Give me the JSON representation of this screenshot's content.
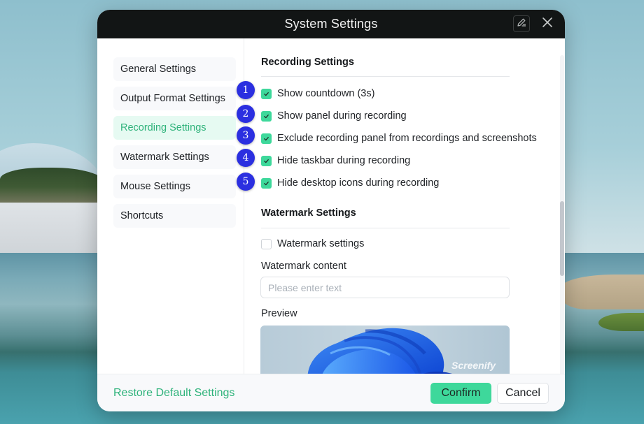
{
  "window": {
    "title": "System Settings",
    "edit_icon": "pen-edit-icon",
    "close_icon": "close-icon"
  },
  "sidebar": {
    "items": [
      {
        "label": "General Settings",
        "active": false
      },
      {
        "label": "Output Format Settings",
        "active": false
      },
      {
        "label": "Recording Settings",
        "active": true
      },
      {
        "label": "Watermark Settings",
        "active": false
      },
      {
        "label": "Mouse Settings",
        "active": false
      },
      {
        "label": "Shortcuts",
        "active": false
      }
    ]
  },
  "recording": {
    "title": "Recording Settings",
    "options": [
      {
        "label": "Show countdown (3s)",
        "checked": true
      },
      {
        "label": "Show panel during recording",
        "checked": true
      },
      {
        "label": "Exclude recording panel from recordings and screenshots",
        "checked": true
      },
      {
        "label": "Hide taskbar during recording",
        "checked": true
      },
      {
        "label": "Hide desktop icons during recording",
        "checked": true
      }
    ]
  },
  "watermark": {
    "title": "Watermark Settings",
    "enable_label": "Watermark settings",
    "enable_checked": false,
    "content_label": "Watermark content",
    "content_value": "",
    "content_placeholder": "Please enter text",
    "preview_label": "Preview",
    "preview_watermark_text": "Screenify"
  },
  "footer": {
    "restore_label": "Restore Default Settings",
    "confirm_label": "Confirm",
    "cancel_label": "Cancel"
  },
  "annotations": {
    "badges": [
      "1",
      "2",
      "3",
      "4",
      "5"
    ]
  },
  "colors": {
    "accent": "#3ed89b",
    "accent_text": "#2fb37b",
    "titlebar": "#121515",
    "badge": "#2b2fe0"
  }
}
